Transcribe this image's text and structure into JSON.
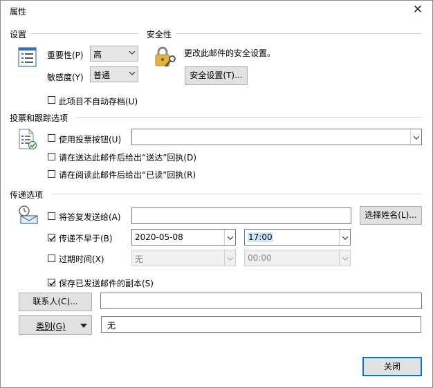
{
  "window": {
    "title": "属性"
  },
  "settings": {
    "group_label": "设置",
    "importance_label": "重要性(P)",
    "importance_value": "高",
    "sensitivity_label": "敏感度(Y)",
    "sensitivity_value": "普通",
    "no_autoarchive_label": "此项目不自动存档(U)",
    "no_autoarchive_checked": false
  },
  "security": {
    "group_label": "安全性",
    "description": "更改此邮件的安全设置。",
    "button_label": "安全设置(T)..."
  },
  "voting": {
    "group_label": "投票和跟踪选项",
    "use_voting_label": "使用投票按钮(U)",
    "use_voting_checked": false,
    "voting_value": "",
    "delivery_receipt_label": "请在送达此邮件后给出“送达”回执(D)",
    "delivery_receipt_checked": false,
    "read_receipt_label": "请在阅读此邮件后给出“已读”回执(R)",
    "read_receipt_checked": false
  },
  "delivery": {
    "group_label": "传递选项",
    "reply_to_label": "将答复发送给(A)",
    "reply_to_checked": false,
    "reply_to_value": "",
    "select_names_label": "选择姓名(L)...",
    "deliver_after_label": "传递不早于(B)",
    "deliver_after_checked": true,
    "deliver_after_date": "2020-05-08",
    "deliver_after_time": "17:00",
    "expires_label": "过期时间(X)",
    "expires_checked": false,
    "expires_date": "无",
    "expires_time": "00:00",
    "save_copy_label": "保存已发送邮件的副本(S)",
    "save_copy_checked": true
  },
  "contacts": {
    "button_label": "联系人(C)...",
    "value": ""
  },
  "categories": {
    "button_label": "类别(G)",
    "value": "无"
  },
  "footer": {
    "close_label": "关闭"
  },
  "colors": {
    "accent": "#0078d7",
    "button_face": "#e1e1e1",
    "selection": "#cce8ff"
  }
}
